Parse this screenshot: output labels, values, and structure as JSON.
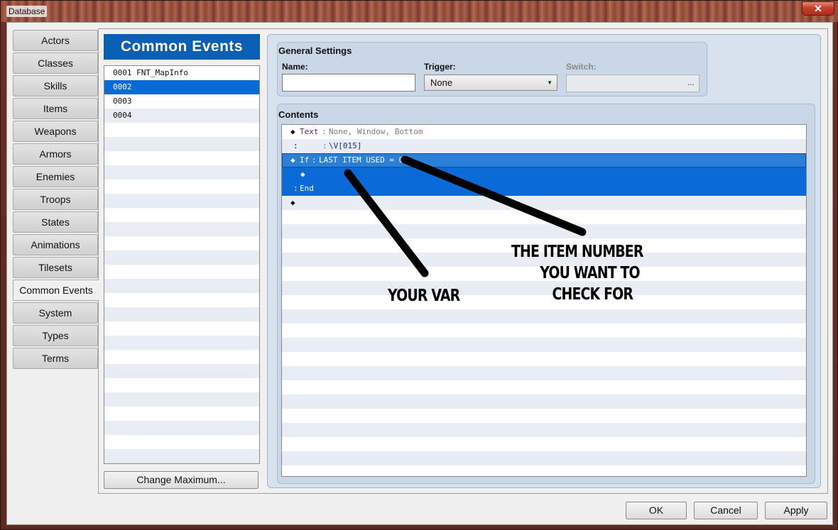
{
  "window": {
    "title": "Database",
    "close_glyph": "✕"
  },
  "tabs": [
    {
      "label": "Actors"
    },
    {
      "label": "Classes"
    },
    {
      "label": "Skills"
    },
    {
      "label": "Items"
    },
    {
      "label": "Weapons"
    },
    {
      "label": "Armors"
    },
    {
      "label": "Enemies"
    },
    {
      "label": "Troops"
    },
    {
      "label": "States"
    },
    {
      "label": "Animations"
    },
    {
      "label": "Tilesets"
    },
    {
      "label": "Common Events",
      "active": true
    },
    {
      "label": "System"
    },
    {
      "label": "Types"
    },
    {
      "label": "Terms"
    }
  ],
  "common_events": {
    "header": "Common Events",
    "items": [
      {
        "label": "0001 FNT_MapInfo"
      },
      {
        "label": "0002",
        "selected": true
      },
      {
        "label": "0003"
      },
      {
        "label": "0004"
      }
    ],
    "change_max_label": "Change Maximum..."
  },
  "general": {
    "title": "General Settings",
    "name_label": "Name:",
    "name_value": "",
    "trigger_label": "Trigger:",
    "trigger_value": "None",
    "switch_label": "Switch:",
    "switch_button": "..."
  },
  "contents": {
    "title": "Contents",
    "rows": [
      {
        "diamond": "◆",
        "keyword": "Text",
        "sep": ":",
        "text": "None, Window, Bottom"
      },
      {
        "lead": ":",
        "sep": ":",
        "text": "\\V[015]"
      },
      {
        "diamond": "◆",
        "keyword": "If",
        "sep": ":",
        "text": "LAST ITEM USED = 0"
      },
      {
        "inner_diamond": "◆"
      },
      {
        "lead": ":",
        "keyword": "End"
      },
      {
        "diamond": "◆"
      }
    ]
  },
  "annotations": {
    "item_number": "THE ITEM NUMBER\n       YOU WANT TO\n          CHECK FOR",
    "your_var": "YOUR VAR"
  },
  "buttons": {
    "ok": "OK",
    "cancel": "Cancel",
    "apply": "Apply"
  }
}
